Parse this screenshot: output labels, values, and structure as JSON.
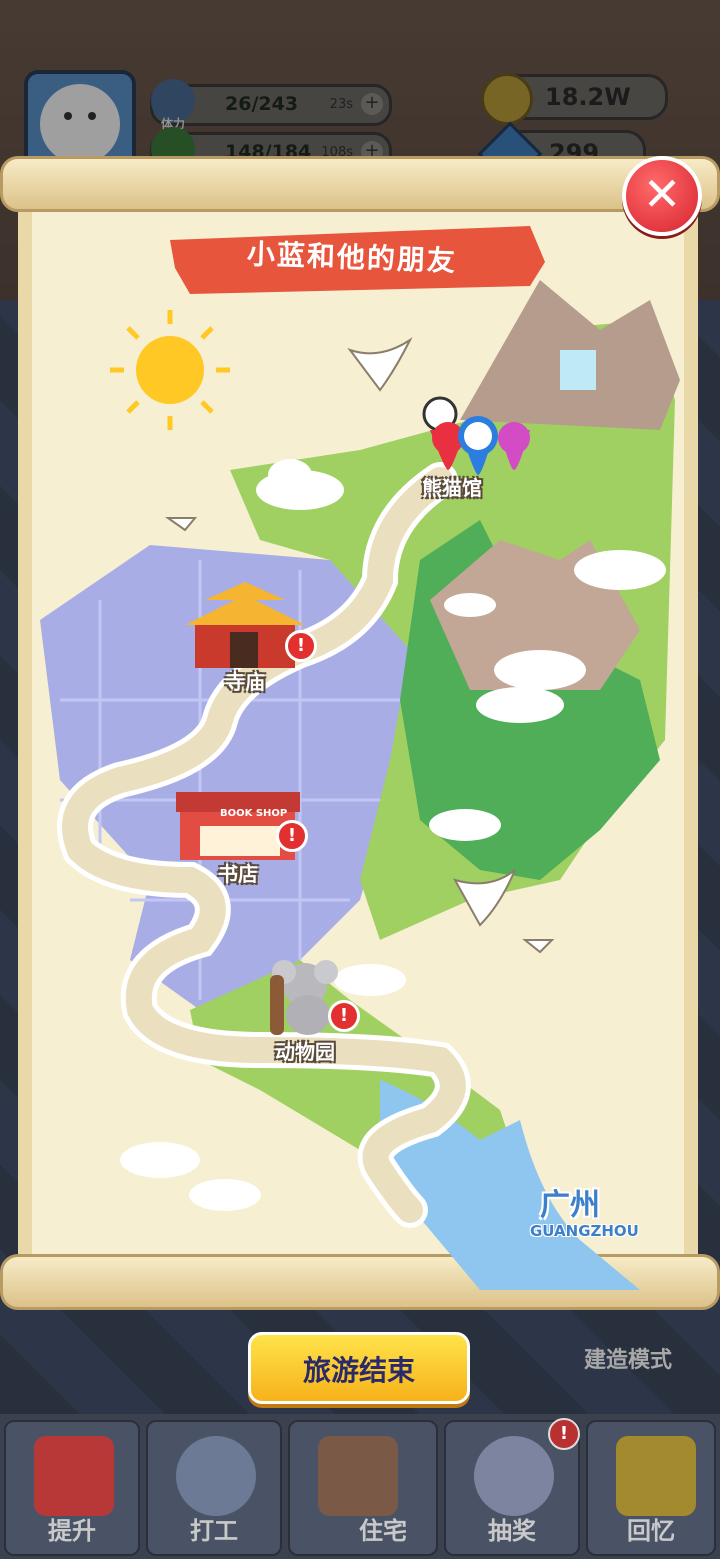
{
  "hud": {
    "stamina_label": "体力",
    "stamina_value": "26/243",
    "stamina_timer": "23s",
    "health_value": "148/184",
    "health_timer": "108s",
    "gold": "18.2W",
    "gems": "299"
  },
  "map": {
    "title": "小蓝和他的朋友",
    "city_name": "广州",
    "city_name_en": "GUANGZHOU",
    "places": [
      {
        "name": "熊猫馆",
        "has_alert": false
      },
      {
        "name": "寺庙",
        "has_alert": true
      },
      {
        "name": "书店",
        "has_alert": true,
        "sign": "BOOK SHOP"
      },
      {
        "name": "动物园",
        "has_alert": true
      }
    ],
    "alert_symbol": "!"
  },
  "close_symbol": "✕",
  "end_button": "旅游结束",
  "build_mode": "建造模式",
  "nav": [
    {
      "label": "提升",
      "icon": "book-icon"
    },
    {
      "label": "打工",
      "icon": "worker-icon"
    },
    {
      "label": "住宅",
      "icon": "house-icon"
    },
    {
      "label": "抽奖",
      "icon": "gacha-icon"
    },
    {
      "label": "回忆",
      "icon": "camera-icon"
    }
  ],
  "nav_alert": "!"
}
